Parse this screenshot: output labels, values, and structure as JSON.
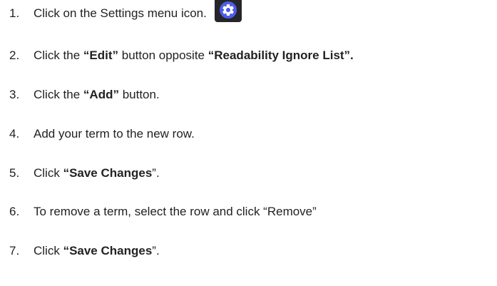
{
  "steps": [
    {
      "num": "1.",
      "segments": [
        {
          "text": "Click on the Settings menu icon.",
          "bold": false
        }
      ],
      "icon": "gear-icon"
    },
    {
      "num": "2.",
      "segments": [
        {
          "text": "Click the ",
          "bold": false
        },
        {
          "text": "“Edit”",
          "bold": true
        },
        {
          "text": " button opposite ",
          "bold": false
        },
        {
          "text": "“Readability Ignore List”.",
          "bold": true
        }
      ]
    },
    {
      "num": "3.",
      "segments": [
        {
          "text": "Click the ",
          "bold": false
        },
        {
          "text": "“Add”",
          "bold": true
        },
        {
          "text": " button.",
          "bold": false
        }
      ]
    },
    {
      "num": "4.",
      "segments": [
        {
          "text": "Add your term to the new row.",
          "bold": false
        }
      ]
    },
    {
      "num": "5.",
      "segments": [
        {
          "text": "Click ",
          "bold": false
        },
        {
          "text": "“Save Changes",
          "bold": true
        },
        {
          "text": "”.",
          "bold": false
        }
      ]
    },
    {
      "num": "6.",
      "segments": [
        {
          "text": "To remove a term, select the row and click “Remove”",
          "bold": false
        }
      ]
    },
    {
      "num": "7.",
      "segments": [
        {
          "text": "Click ",
          "bold": false
        },
        {
          "text": "“Save Changes",
          "bold": true
        },
        {
          "text": "”.",
          "bold": false
        }
      ]
    }
  ],
  "colors": {
    "text": "#222222",
    "icon_bg": "#25252a",
    "icon_accent": "#4f5ce8"
  }
}
